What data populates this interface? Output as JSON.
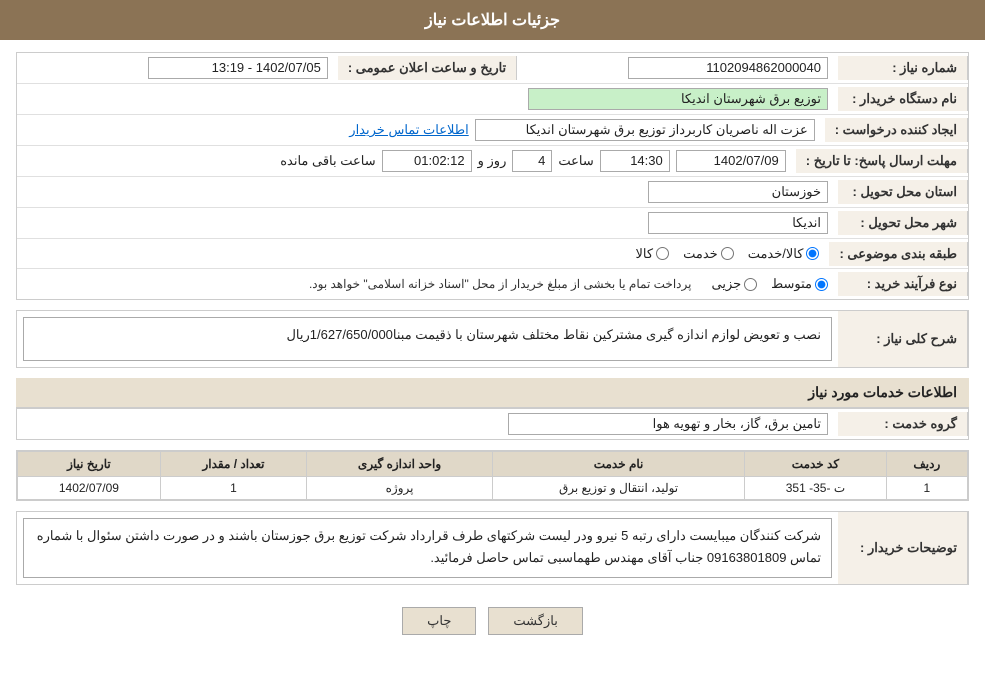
{
  "header": {
    "title": "جزئیات اطلاعات نیاز"
  },
  "form": {
    "shomareNiaz": {
      "label": "شماره نیاز :",
      "value": "1102094862000040"
    },
    "namDastgah": {
      "label": "نام دستگاه خریدار :",
      "value": "توزیع برق شهرستان اندیکا"
    },
    "ijadKonande": {
      "label": "ایجاد کننده درخواست :",
      "value": "عزت اله ناصریان کاربرداز توزیع برق شهرستان اندیکا"
    },
    "contactInfo": {
      "label": "اطلاعات تماس خریدار"
    },
    "mohlatErsalPasokh": {
      "label": "مهلت ارسال پاسخ: تا تاریخ :",
      "date": "1402/07/09",
      "time": "14:30",
      "days": "4",
      "remaining": "01:02:12"
    },
    "ostanTahvil": {
      "label": "استان محل تحویل :",
      "value": "خوزستان"
    },
    "shahrTahvil": {
      "label": "شهر محل تحویل :",
      "value": "اندیکا"
    },
    "tabaqeBandiMovzooee": {
      "label": "طبقه بندی موضوعی :",
      "options": [
        "کالا",
        "خدمت",
        "کالا/خدمت"
      ],
      "selected": "کالا/خدمت"
    },
    "noefarayandKhrid": {
      "label": "نوع فرآیند خرید :",
      "options": [
        "جزیی",
        "متوسط"
      ],
      "selected": "متوسط",
      "notice": "پرداخت تمام یا بخشی از مبلغ خریدار از محل \"اسناد خزانه اسلامی\" خواهد بود."
    },
    "publicDateTime": {
      "label": "تاریخ و ساعت اعلان عمومی :",
      "value": "1402/07/05 - 13:19"
    }
  },
  "shahKoliNiaz": {
    "label": "شرح کلی نیاز :",
    "value": "نصب و تعویض لوازم اندازه گیری مشترکین نقاط مختلف شهرستان با ذقیمت مبنا1/627/650/000ریال"
  },
  "khadamatSection": {
    "title": "اطلاعات خدمات مورد نیاز",
    "goroheKhedmat": {
      "label": "گروه خدمت :",
      "value": "تامین برق، گاز، بخار و تهویه هوا"
    }
  },
  "table": {
    "headers": [
      "ردیف",
      "کد خدمت",
      "نام خدمت",
      "واحد اندازه گیری",
      "تعداد / مقدار",
      "تاریخ نیاز"
    ],
    "rows": [
      {
        "radif": "1",
        "codeKhedmat": "ت -35- 351",
        "nameKhedmat": "تولید، انتقال و توزیع برق",
        "vahedAndaze": "پروژه",
        "tedad": "1",
        "tarikh": "1402/07/09"
      }
    ]
  },
  "tosihKharidar": {
    "label": "توضیحات خریدار :",
    "value": "شرکت کنندگان میبایست دارای رتبه 5 نیرو ودر لیست شرکتهای طرف قرارداد شرکت توزیع برق جوزستان باشند و در صورت داشتن سئوال با شماره تماس 09163801809 جناب آقای مهندس طهماسبی تماس حاصل فرمائید."
  },
  "buttons": {
    "print": "چاپ",
    "back": "بازگشت"
  },
  "labels": {
    "roz": "روز و",
    "saatMande": "ساعت باقی مانده",
    "saat": "ساعت"
  }
}
